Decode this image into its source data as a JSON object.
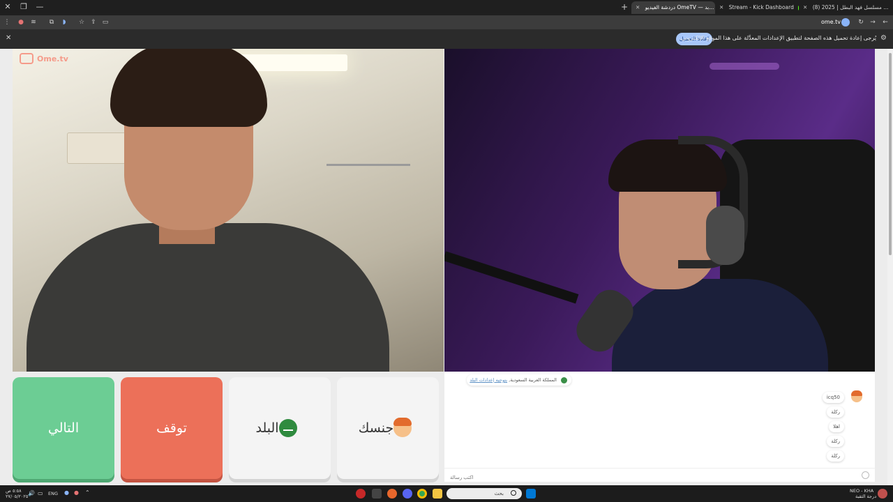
{
  "browser": {
    "tabs": [
      {
        "title": "مسلسل فهد البطل | 2025 (8) ...",
        "active": false,
        "favicon_color": "#ff0033"
      },
      {
        "title": "Stream - Kick Dashboard",
        "active": false,
        "favicon_color": "#53fc18"
      },
      {
        "title": "دردشة الفيديو OmeTV — بد...",
        "active": true,
        "favicon_color": "#e05252"
      }
    ],
    "url": "ome.tv",
    "infobar": {
      "message": "يُرجى إعادة تحميل هذه الصفحة لتطبيق الإعدادات المعدَّلة على هذا الموقع الإلكتروني.",
      "reload_label": "إعادة التحميل"
    }
  },
  "app": {
    "logo_text": "Ome.tv",
    "controls": {
      "next_label": "التالي",
      "stop_label": "توقف",
      "country_label": "البلد",
      "gender_label": "جنسك"
    },
    "chat": {
      "system_message": {
        "country_text": "المملكة العربية السعودية",
        "link_text": "بتوجيه إعدادات البلد"
      },
      "messages": [
        {
          "text": "icq50"
        },
        {
          "text": "ركلة"
        },
        {
          "text": "اهلا"
        },
        {
          "text": "ركلة"
        },
        {
          "text": "ركلة"
        }
      ],
      "input_placeholder": "اكتب رسالة"
    }
  },
  "taskbar": {
    "left_time": "٥:٥٨ ص",
    "left_date": "٢٧/٠٥/٢٠٢٥",
    "language": "ENG",
    "search_text": "بحث",
    "right_line1": "NEO - KHA",
    "right_line2": "درجة الثقبة"
  },
  "colors": {
    "next": "#6ccd94",
    "stop": "#ec7059",
    "accent_blue": "#a8c7fa"
  }
}
